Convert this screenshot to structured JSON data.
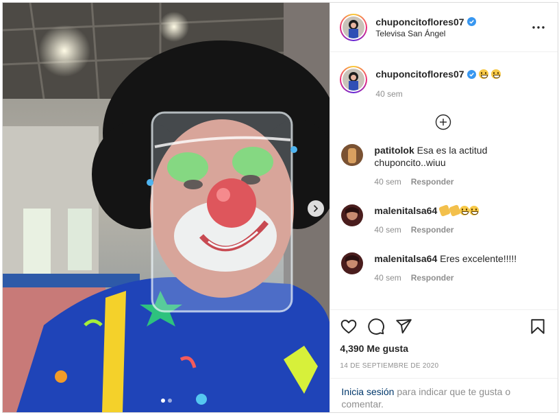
{
  "header": {
    "username": "chuponcitoflores07",
    "location": "Televisa San Ángel"
  },
  "caption": {
    "username": "chuponcitoflores07",
    "time": "40 sem"
  },
  "comments": [
    {
      "username": "patitolok",
      "text": "Esa es la actitud chuponcito..wiuu",
      "time": "40 sem",
      "reply_label": "Responder"
    },
    {
      "username": "malenitalsa64",
      "text": "",
      "time": "40 sem",
      "reply_label": "Responder"
    },
    {
      "username": "malenitalsa64",
      "text": "Eres excelente!!!!!",
      "time": "40 sem",
      "reply_label": "Responder"
    }
  ],
  "likes": "4,390 Me gusta",
  "date": "14 DE SEPTIEMBRE DE 2020",
  "login": {
    "link": "Inicia sesión",
    "text": " para indicar que te gusta o comentar."
  },
  "colors": {
    "verified": "#3897f0",
    "link": "#00376b",
    "muted": "#8e8e8e"
  },
  "icons": [
    "more-icon",
    "add-comments-icon",
    "like-icon",
    "comment-icon",
    "share-icon",
    "save-icon",
    "next-arrow-icon"
  ],
  "carousel": {
    "count": 2,
    "active": 1
  }
}
